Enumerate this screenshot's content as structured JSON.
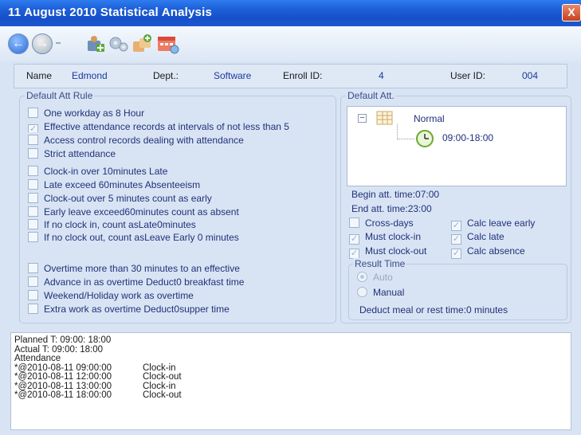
{
  "window": {
    "title": "11 August 2010 Statistical Analysis",
    "close_label": "X"
  },
  "toolbar": {
    "buttons": [
      {
        "name": "back-button",
        "icon": "left-arrow-icon",
        "glyph": "←"
      },
      {
        "name": "forward-button",
        "icon": "right-arrow-icon",
        "glyph": "→"
      },
      {
        "name": "user-button",
        "icon": "user-icon"
      },
      {
        "name": "settings-button",
        "icon": "gear-icon"
      },
      {
        "name": "group-button",
        "icon": "group-icon"
      },
      {
        "name": "calendar-button",
        "icon": "calendar-icon"
      }
    ]
  },
  "employee": {
    "name_label": "Name",
    "name": "Edmond",
    "dept_label": "Dept.:",
    "dept": "Software",
    "enroll_label": "Enroll ID:",
    "enroll_id": "4",
    "user_label": "User ID:",
    "user_id": "004"
  },
  "default_att_rule": {
    "title": "Default Att Rule",
    "rules": [
      {
        "label": "One workday as 8 Hour",
        "checked": false
      },
      {
        "label": "Effective attendance records at intervals of not less than 5",
        "checked": true
      },
      {
        "label": "Access control records dealing with attendance",
        "checked": false
      },
      {
        "label": "Strict attendance",
        "checked": false
      },
      {
        "label": "Clock-in over 10minutes Late",
        "checked": false
      },
      {
        "label": "Late exceed 60minutes Absenteeism",
        "checked": false
      },
      {
        "label": "Clock-out over 5 minutes count as early",
        "checked": false
      },
      {
        "label": "Early leave exceed60minutes count as absent",
        "checked": false
      },
      {
        "label": "If no clock in, count asLate0minutes",
        "checked": false
      },
      {
        "label": "If no clock out, count asLeave Early 0 minutes",
        "checked": false
      },
      {
        "label": "Overtime more than 30 minutes to an effective",
        "checked": false
      },
      {
        "label": "Advance in as overtime Deduct0 breakfast time",
        "checked": false
      },
      {
        "label": "Weekend/Holiday work as overtime",
        "checked": false
      },
      {
        "label": "Extra work as overtime Deduct0supper time",
        "checked": false
      }
    ]
  },
  "default_att": {
    "title": "Default Att.",
    "tree_root": "Normal",
    "tree_expander": "−",
    "tree_child": "09:00-18:00",
    "begin_time": "Begin att. time:07:00",
    "end_time": "End att. time:23:00",
    "options": [
      {
        "label": "Cross-days",
        "checked": false
      },
      {
        "label": "Calc leave early",
        "checked": true
      },
      {
        "label": "Must clock-in",
        "checked": true
      },
      {
        "label": "Calc late",
        "checked": true
      },
      {
        "label": "Must clock-out",
        "checked": true
      },
      {
        "label": "Calc absence",
        "checked": true
      }
    ],
    "result_time": {
      "title": "Result Time",
      "auto": "Auto",
      "manual": "Manual",
      "selected": "Auto"
    },
    "deduct": "Deduct meal or rest time:0 minutes"
  },
  "log": {
    "planned": "Planned T: 09:00: 18:00",
    "actual": "Actual T: 09:00: 18:00",
    "attendance": "Attendance",
    "records": [
      {
        "datetime": "*@2010-08-11 09:00:00",
        "action": "Clock-in"
      },
      {
        "datetime": "*@2010-08-11 12:00:00",
        "action": "Clock-out"
      },
      {
        "datetime": "*@2010-08-11 13:00:00",
        "action": "Clock-in"
      },
      {
        "datetime": "*@2010-08-11 18:00:00",
        "action": "Clock-out"
      }
    ]
  },
  "colors": {
    "titlebar": "#1d5fd8",
    "accent_text": "#1a3aa0",
    "rule_text": "#22307a",
    "window_bg": "#d8e4f3"
  }
}
